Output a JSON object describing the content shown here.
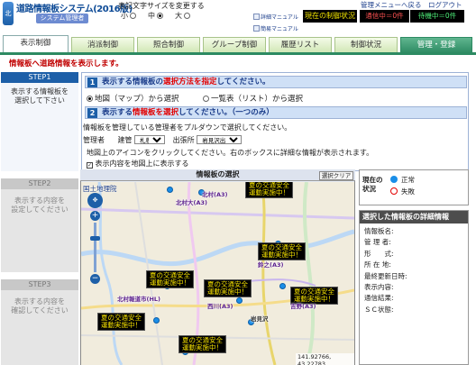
{
  "header": {
    "logo_mark": "北",
    "title": "道路情報板システム(2016版)",
    "subtitle": "システム管理者",
    "font_size_label": "表記文字サイズを変更する",
    "font_sizes": [
      {
        "label": "小",
        "selected": false
      },
      {
        "label": "中",
        "selected": true
      },
      {
        "label": "大",
        "selected": false
      }
    ],
    "manual_detail": "詳細マニュアル",
    "manual_summary": "簡易マニュアル",
    "status_label": "現在の制御状況",
    "comm_label": "通信中＝0件",
    "wait_label": "待機中＝0件",
    "top_links": "管理メニューへ戻る　ログアウト"
  },
  "tabs": [
    {
      "label": "表示制御",
      "active": true
    },
    {
      "label": "消派制御",
      "active": false
    },
    {
      "label": "照合制御",
      "active": false
    },
    {
      "label": "グループ制御",
      "active": false
    },
    {
      "label": "履歴リスト",
      "active": false
    },
    {
      "label": "制御状況",
      "active": false
    },
    {
      "label": "管理・登録",
      "active": false
    }
  ],
  "notice": "情報板へ道路情報を表示します。",
  "steps": [
    {
      "head": "STEP1",
      "body": "表示する情報板を\n選択して下さい",
      "active": true
    },
    {
      "head": "STEP2",
      "body": "表示する内容を\n設定してください",
      "active": false
    },
    {
      "head": "STEP3",
      "body": "表示する内容を\n確認してください",
      "active": false
    }
  ],
  "section1": {
    "num": "1",
    "title_pre": "表示する情報板の",
    "title_red": "選択方法を指定",
    "title_post": "してください。",
    "options": [
      {
        "label": "地図（マップ）から選択",
        "selected": true
      },
      {
        "label": "一覧表（リスト）から選択",
        "selected": false
      }
    ]
  },
  "section2": {
    "num": "2",
    "title_pre": "表示する",
    "title_red": "情報板を選択",
    "title_post": "してください。（一つのみ）",
    "help1": "情報板を管理している管理者をプルダウンで選択してください。",
    "manager_label": "管理者",
    "kensetsu_label": "建管",
    "kensetsu_value": "札幌",
    "office_label": "出張所",
    "office_value": "岩見沢出張所",
    "help2": "地図上のアイコンをクリックしてください。右のボックスに詳細な情報が表示されます。",
    "checkbox_label": "表示内容を地図上に表示する",
    "checkbox_checked": true
  },
  "map": {
    "title": "情報板の選択",
    "clear_label": "選択クリア",
    "attribution": "国土地理院",
    "coords": "141.92766, 43.22783",
    "signs": [
      {
        "line1": "夏の交通安全",
        "line2": "運動実施中！"
      },
      {
        "line1": "夏の交通安全",
        "line2": "運動実施中！"
      },
      {
        "line1": "夏の交通安全",
        "line2": "運動実施中！"
      },
      {
        "line1": "夏の交通安全",
        "line2": "運動実施中！"
      },
      {
        "line1": "夏の交通安全",
        "line2": "運動実施中！"
      },
      {
        "line1": "夏の交通安全",
        "line2": "運動実施中！"
      },
      {
        "line1": "夏の交通安全",
        "line2": "運動実施中！"
      }
    ],
    "labels": [
      "北村(A3)",
      "北村大(A3)",
      "西川(A3)",
      "北村報道市(HL)",
      "吉野(A3)",
      "鈴之(A3)",
      "岩見沢"
    ]
  },
  "legend": {
    "title": "現在の\n状況",
    "normal_label": "正常",
    "error_label": "失敗",
    "normal_color": "#1a8ee8",
    "error_color": "#e30000"
  },
  "detail": {
    "title": "選択した情報板の詳細情報",
    "fields": [
      "情報板名:",
      "管 理 者:",
      "形　　式:",
      "所 在 地:",
      "最終更新日時:",
      "表示内容:",
      "通信結果:",
      "ＳＣ状態:"
    ]
  }
}
